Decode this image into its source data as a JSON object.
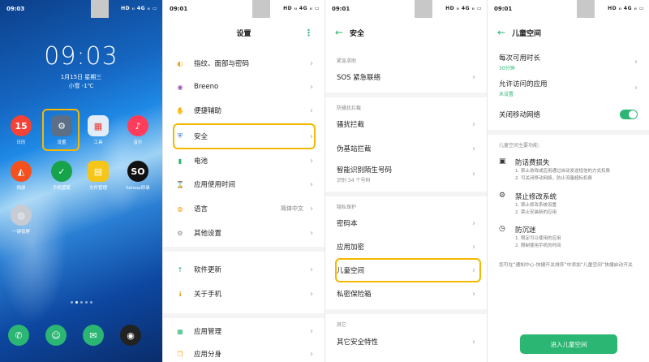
{
  "home": {
    "status_time": "09:03",
    "status_icons": "HD ᵢₗ 4G ᵢₗ ▭",
    "clock": "09:03",
    "date": "1月15日 星期三",
    "weather": "小雪 -1℃",
    "apps": [
      {
        "label": "日历",
        "glyph": "15",
        "color": "#f44336"
      },
      {
        "label": "设置",
        "glyph": "⚙",
        "color": "#5c6f86"
      },
      {
        "label": "工具",
        "glyph": "▦",
        "color": "#e3edf8"
      },
      {
        "label": "音乐",
        "glyph": "♪",
        "color": "#ff3d5a"
      },
      {
        "label": "相册",
        "glyph": "◭",
        "color": "#f4511e"
      },
      {
        "label": "手机管家",
        "glyph": "✓",
        "color": "#17a34a"
      },
      {
        "label": "文件管理",
        "glyph": "▤",
        "color": "#f5c518"
      },
      {
        "label": "Soloop即录",
        "glyph": "SO",
        "color": "#111111"
      },
      {
        "label": "一键锁屏",
        "glyph": "◎",
        "color": "#c7ccd4"
      }
    ],
    "dock": [
      {
        "name": "phone",
        "glyph": "✆",
        "color": "#2bb673"
      },
      {
        "name": "contacts",
        "glyph": "☺",
        "color": "#2bb673"
      },
      {
        "name": "messages",
        "glyph": "✉",
        "color": "#2bb673"
      },
      {
        "name": "camera",
        "glyph": "◉",
        "color": "#222222"
      }
    ]
  },
  "settings": {
    "status_time": "09:01",
    "status_icons": "HD ᵢₗ 4G ᵢₗ ▭",
    "title": "设置",
    "items": [
      {
        "label": "指纹、面部与密码",
        "icon": "fingerprint-icon",
        "glyph": "◐",
        "color": "#f39c12"
      },
      {
        "label": "Breeno",
        "icon": "breeno-icon",
        "glyph": "◉",
        "color": "#9b59b6"
      },
      {
        "label": "便捷辅助",
        "icon": "hand-icon",
        "glyph": "✋",
        "color": "#f39c12"
      },
      {
        "label": "安全",
        "icon": "shield-icon",
        "glyph": "⛨",
        "color": "#3b6fd4"
      },
      {
        "label": "电池",
        "icon": "battery-icon",
        "glyph": "▮",
        "color": "#2bb673"
      },
      {
        "label": "应用使用时间",
        "icon": "hourglass-icon",
        "glyph": "⌛",
        "color": "#2bb673"
      },
      {
        "label": "语言",
        "icon": "language-icon",
        "glyph": "◍",
        "color": "#f39c12",
        "value": "简体中文"
      },
      {
        "label": "其他设置",
        "icon": "more-settings-icon",
        "glyph": "⚙",
        "color": "#888888"
      },
      {
        "label": "软件更新",
        "icon": "update-icon",
        "glyph": "↑",
        "color": "#2bb673"
      },
      {
        "label": "关于手机",
        "icon": "info-icon",
        "glyph": "ℹ",
        "color": "#f39c12"
      },
      {
        "label": "应用管理",
        "icon": "apps-icon",
        "glyph": "▦",
        "color": "#2bb673"
      },
      {
        "label": "应用分身",
        "icon": "clone-icon",
        "glyph": "❐",
        "color": "#f39c12"
      }
    ]
  },
  "security": {
    "status_time": "09:01",
    "status_icons": "HD ᵢₗ 4G ᵢₗ ▭",
    "title": "安全",
    "sec_emergency": "紧急求助",
    "sos": "SOS 紧急联络",
    "sec_block": "防骚扰拦截",
    "harass": "骚扰拦截",
    "fakebase": "伪基站拦截",
    "smartid": "智能识别陌生号码",
    "smartid_sub": "识别 34 个号码",
    "sec_privacy": "隐私保护",
    "passbook": "密码本",
    "applock": "应用加密",
    "kidspace": "儿童空间",
    "safebox": "私密保险箱",
    "sec_other": "其它",
    "other": "其它安全特性"
  },
  "kids": {
    "status_time": "09:01",
    "status_icons": "HD ᵢₗ 4G ᵢₗ ▭",
    "title": "儿童空间",
    "duration_label": "每次可用时长",
    "duration_value": "30分钟",
    "allowed_label": "允许访问的应用",
    "allowed_value": "未设置",
    "network_label": "关闭移动网络",
    "features_title": "儿童空间主要功能：",
    "f1_title": "防话费损失",
    "f1_l1": "1. 禁止游戏或应用通过自动发送短信的方式扣费",
    "f1_l2": "2. 可关闭移动网络，防止流量超标扣费",
    "f2_title": "禁止修改系统",
    "f2_l1": "1. 禁止修改系统设置",
    "f2_l2": "2. 禁止安装新的应用",
    "f3_title": "防沉迷",
    "f3_l1": "1. 限定可以使用的应用",
    "f3_l2": "2. 限制使用手机的时间",
    "note": "您可在“通知中心-快捷开关排序”中添加“儿童空间”快捷启动开关",
    "enter_button": "进入儿童空间"
  }
}
